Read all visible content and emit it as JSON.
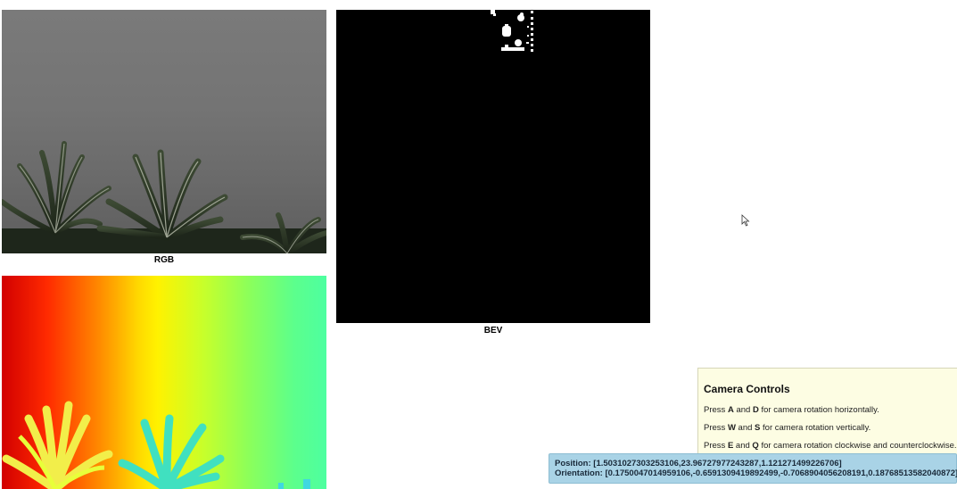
{
  "panels": {
    "rgb_label": "RGB",
    "bev_label": "BEV"
  },
  "camera_controls": {
    "title": "Camera Controls",
    "lines": [
      {
        "prefix": "Press ",
        "key1": "A",
        "mid": " and ",
        "key2": "D",
        "suffix": " for camera rotation horizontally."
      },
      {
        "prefix": "Press ",
        "key1": "W",
        "mid": " and ",
        "key2": "S",
        "suffix": " for camera rotation vertically."
      },
      {
        "prefix": "Press ",
        "key1": "E",
        "mid": " and ",
        "key2": "Q",
        "suffix": " for camera rotation clockwise and counterclockwise."
      }
    ]
  },
  "pose": {
    "position": "Position: [1.5031027303253106,23.96727977243287,1.121271499226706]",
    "orientation": "Orientation: [0.1750047014959106,-0.6591309419892499,-0.7068904056208191,0.18768513582040872]"
  },
  "colors": {
    "bev_background": "#000000",
    "controls_background": "#fdfde3",
    "pose_background": "#a9d3e6"
  },
  "icons": {
    "cursor": "mouse-pointer-icon"
  }
}
